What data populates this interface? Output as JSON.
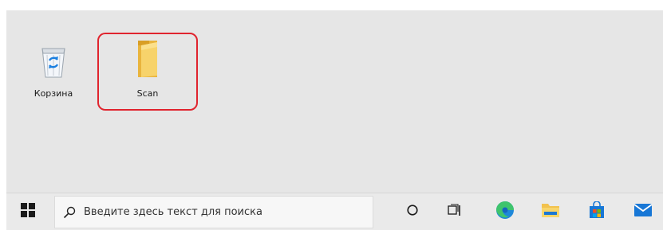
{
  "desktop": {
    "icons": [
      {
        "label": "Корзина",
        "icon": "recycle-bin-icon"
      },
      {
        "label": "Scan",
        "icon": "folder-icon",
        "highlighted": true
      }
    ],
    "highlight_color": "#e0242e",
    "background": "#e6e6e6"
  },
  "taskbar": {
    "start_icon": "windows-logo-icon",
    "search": {
      "icon": "search-icon",
      "placeholder": "Введите здесь текст для поиска"
    },
    "buttons": [
      {
        "icon": "cortana-icon"
      },
      {
        "icon": "task-view-icon"
      },
      {
        "icon": "edge-icon",
        "color": "#1e88d9"
      },
      {
        "icon": "file-explorer-icon",
        "color": "#f2c24e"
      },
      {
        "icon": "store-icon",
        "color": "#1877d6"
      },
      {
        "icon": "mail-icon",
        "color": "#1877d6"
      }
    ]
  }
}
